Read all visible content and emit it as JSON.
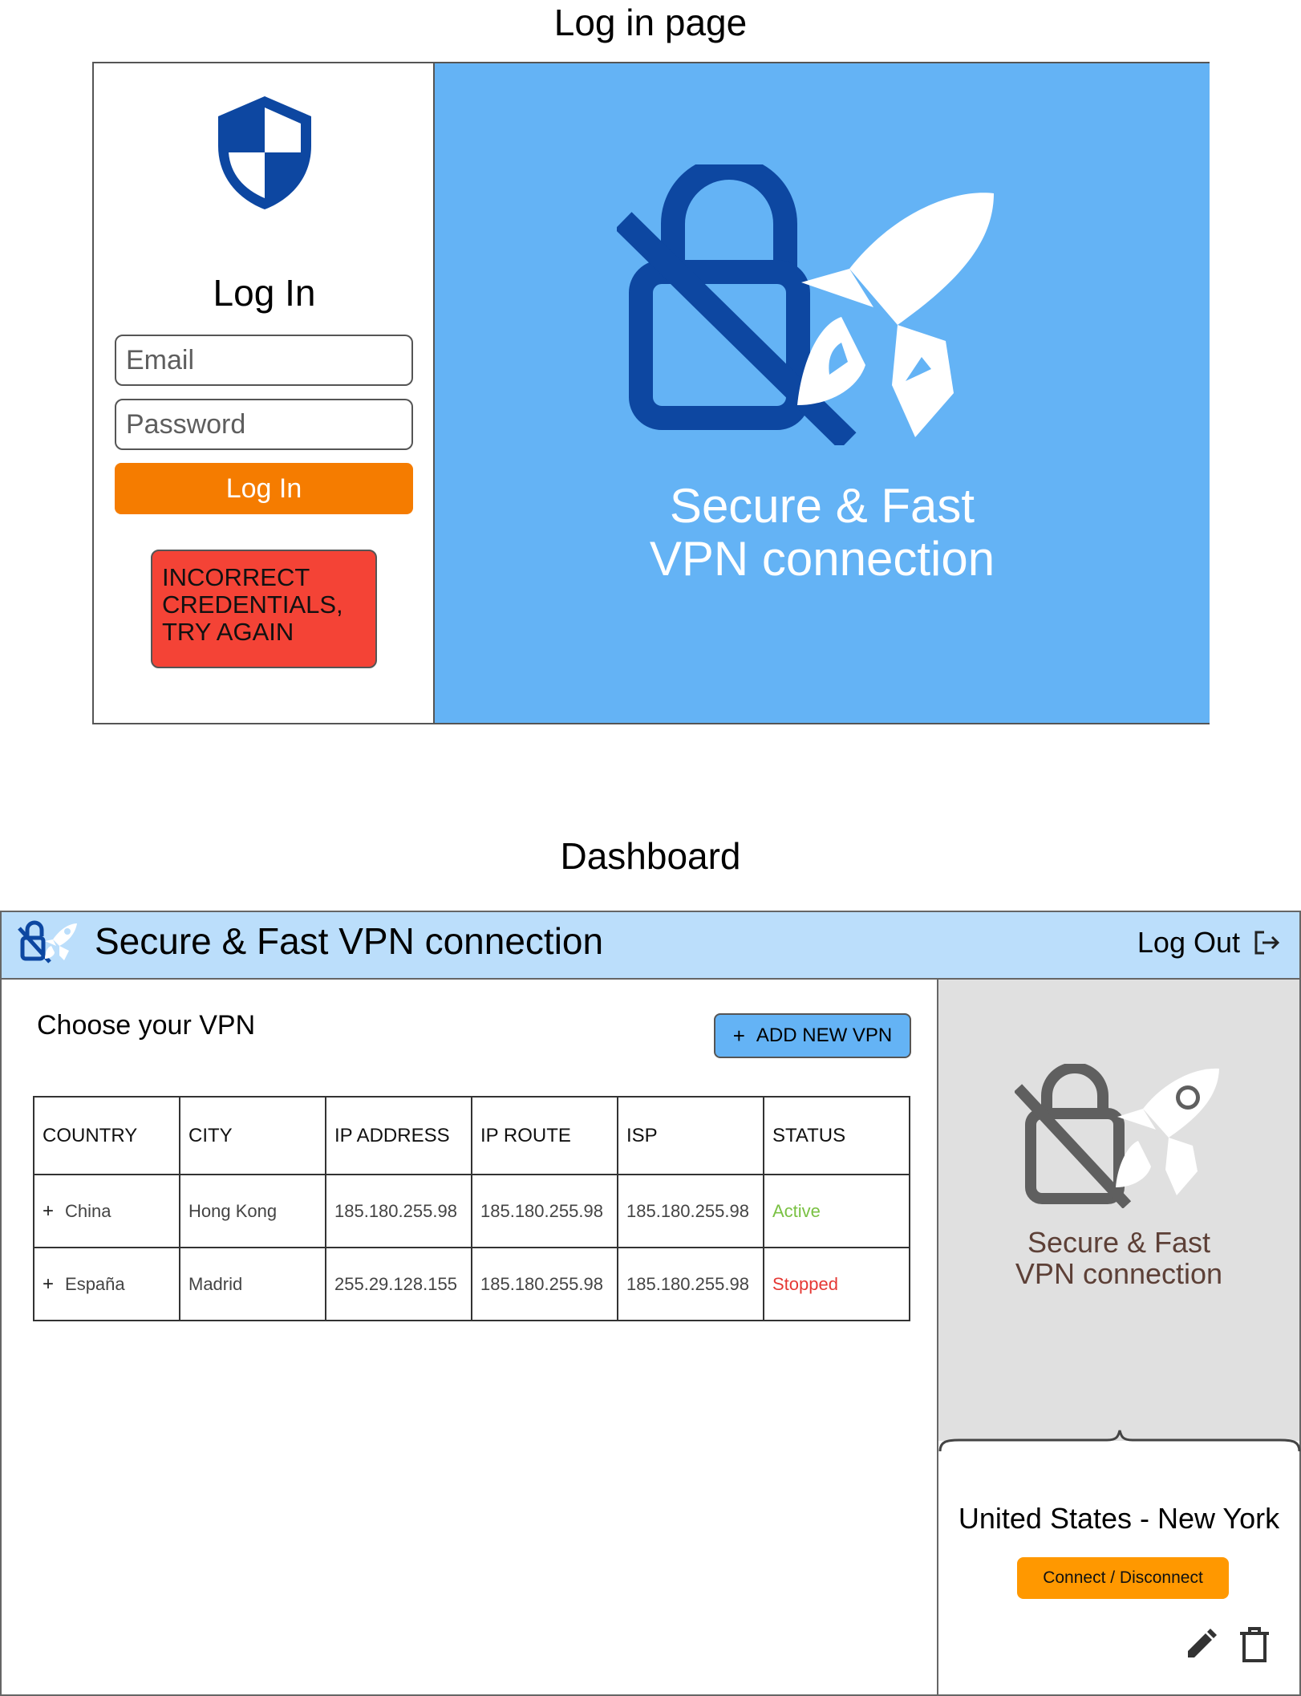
{
  "login_section": {
    "title": "Log in page",
    "heading": "Log In",
    "email_placeholder": "Email",
    "password_placeholder": "Password",
    "login_button": "Log In",
    "error_message": "INCORRECT\nCREDENTIALS,\nTRY AGAIN",
    "hero_text": "Secure & Fast\nVPN connection",
    "colors": {
      "hero_bg": "#64b3f5",
      "shield": "#0d47a1",
      "button": "#f57c00",
      "error": "#f44336"
    },
    "icons": [
      "shield-icon",
      "vpn-lock-rocket-icon"
    ]
  },
  "dashboard": {
    "title": "Dashboard",
    "app_title": "Secure & Fast VPN connection",
    "logout_label": "Log Out",
    "choose_label": "Choose your VPN",
    "add_button": "ADD NEW VPN",
    "table": {
      "columns": [
        "COUNTRY",
        "CITY",
        "IP ADDRESS",
        "IP ROUTE",
        "ISP",
        "STATUS"
      ],
      "rows": [
        {
          "country": "China",
          "city": "Hong Kong",
          "ip_address": "185.180.255.98",
          "ip_route": "185.180.255.98",
          "isp": "185.180.255.98",
          "status": "Active"
        },
        {
          "country": "España",
          "city": "Madrid",
          "ip_address": "255.29.128.155",
          "ip_route": "185.180.255.98",
          "isp": "185.180.255.98",
          "status": "Stopped"
        }
      ]
    },
    "side_panel": {
      "brand_text": "Secure & Fast\nVPN connection",
      "location": "United States - New York",
      "connect_button": "Connect / Disconnect"
    },
    "colors": {
      "header_bg": "#bbdefb",
      "add_button": "#64b3f5",
      "active": "#7ac143",
      "stopped": "#e53935",
      "connect": "#ff9800"
    },
    "icons": [
      "app-logo-icon",
      "logout-icon",
      "plus-icon",
      "edit-icon",
      "delete-icon"
    ]
  }
}
